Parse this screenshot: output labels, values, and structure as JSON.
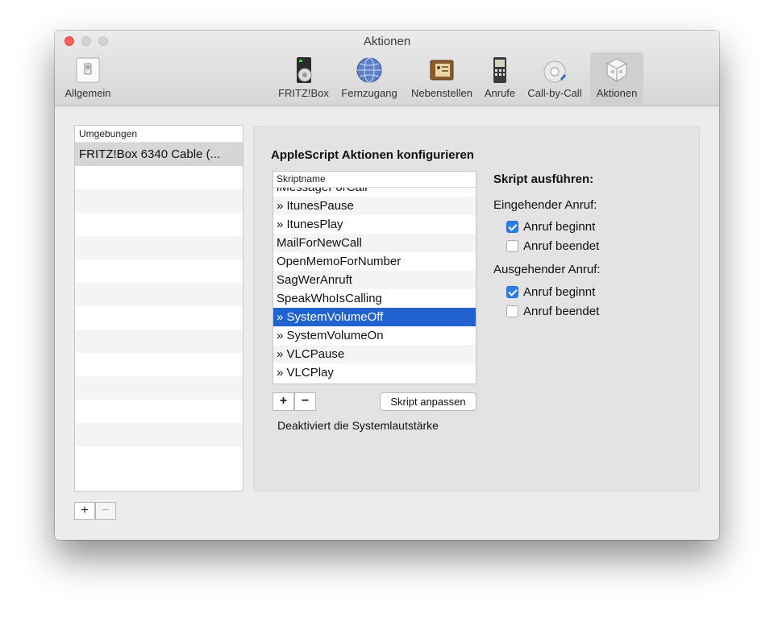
{
  "window": {
    "title": "Aktionen"
  },
  "toolbar": {
    "items": [
      {
        "label": "Allgemein",
        "icon": "switch-icon"
      },
      {
        "label": "FRITZ!Box",
        "icon": "router-icon"
      },
      {
        "label": "Fernzugang",
        "icon": "globe-icon"
      },
      {
        "label": "Nebenstellen",
        "icon": "phonebook-icon"
      },
      {
        "label": "Anrufe",
        "icon": "phone-icon"
      },
      {
        "label": "Call-by-Call",
        "icon": "rotary-phone-icon"
      },
      {
        "label": "Aktionen",
        "icon": "action-puzzle-icon"
      }
    ],
    "active": "Aktionen"
  },
  "environments": {
    "header": "Umgebungen",
    "items": [
      "FRITZ!Box 6340 Cable (..."
    ],
    "add_label": "+",
    "remove_label": "−"
  },
  "main": {
    "title": "AppleScript Aktionen konfigurieren",
    "table_header": "Skriptname",
    "scripts": [
      "iMessageForCall",
      "» ItunesPause",
      "» ItunesPlay",
      "MailForNewCall",
      "OpenMemoForNumber",
      "SagWerAnruft",
      "SpeakWhoIsCalling",
      "» SystemVolumeOff",
      "» SystemVolumeOn",
      "» VLCPause",
      "» VLCPlay"
    ],
    "selected_script": "» SystemVolumeOff",
    "add_label": "+",
    "remove_label": "−",
    "edit_button": "Skript anpassen",
    "description": "Deaktiviert die Systemlautstärke"
  },
  "run": {
    "title": "Skript ausführen:",
    "incoming_label": "Eingehender Anruf:",
    "incoming_start": "Anruf beginnt",
    "incoming_start_checked": true,
    "incoming_end": "Anruf beendet",
    "incoming_end_checked": false,
    "outgoing_label": "Ausgehender Anruf:",
    "outgoing_start": "Anruf beginnt",
    "outgoing_start_checked": true,
    "outgoing_end": "Anruf beendet",
    "outgoing_end_checked": false
  },
  "colors": {
    "selection": "#1f62d0",
    "checkbox": "#2c7de8",
    "close": "#fc605c"
  }
}
